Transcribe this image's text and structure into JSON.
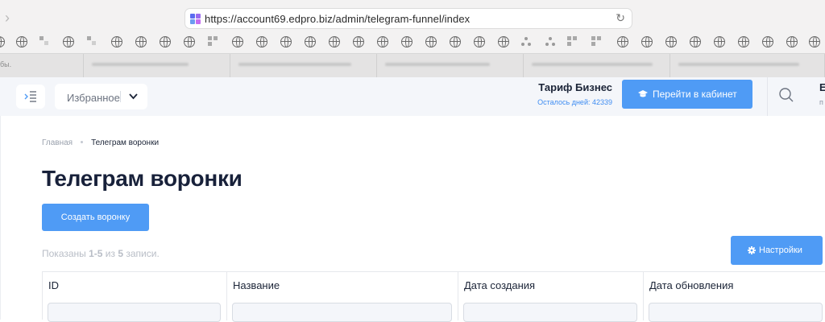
{
  "browser": {
    "url": "https://account69.edpro.biz/admin/telegram-funnel/index",
    "first_tab_fragment": "бы."
  },
  "header": {
    "favorites_label": "Избранное",
    "tariff_name": "Тариф Бизнес",
    "days_left": "Осталось дней: 42339",
    "cabinet_button": "Перейти в кабинет",
    "user_initial": "Е",
    "user_sub": "п"
  },
  "breadcrumb": {
    "home": "Главная",
    "current": "Телеграм воронки"
  },
  "page": {
    "title": "Телеграм воронки",
    "create_button": "Создать воронку",
    "summary_prefix": "Показаны ",
    "summary_range": "1-5",
    "summary_mid": " из ",
    "summary_total": "5",
    "summary_suffix": " записи.",
    "settings_button": "Настройки"
  },
  "table": {
    "columns": [
      "ID",
      "Название",
      "Дата создания",
      "Дата обновления"
    ]
  },
  "colors": {
    "accent": "#4f9bf5",
    "title": "#18213a",
    "link_days": "#3f8df2"
  }
}
